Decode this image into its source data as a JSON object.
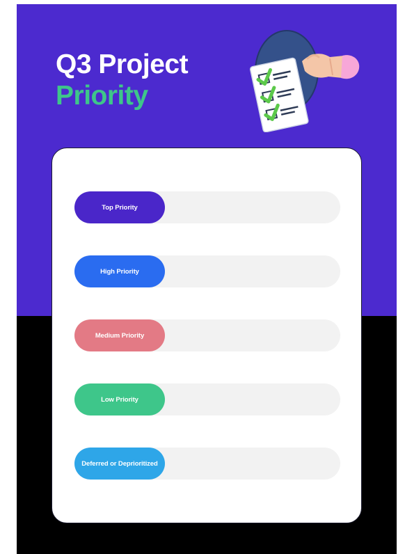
{
  "header": {
    "title_line1": "Q3 Project",
    "title_line2": "Priority"
  },
  "colors": {
    "top_panel": "#4c2acf",
    "bottom_panel": "#000000",
    "title_primary": "#ffffff",
    "title_accent": "#3ec68a",
    "track": "#f2f2f2"
  },
  "illustration": {
    "icon": "checklist-clipboard-with-hand-icon"
  },
  "priorities": [
    {
      "label": "Top Priority",
      "color": "#4a26c9"
    },
    {
      "label": "High Priority",
      "color": "#2a6cf0"
    },
    {
      "label": "Medium Priority",
      "color": "#e37a85"
    },
    {
      "label": "Low Priority",
      "color": "#3ec68a"
    },
    {
      "label": "Deferred or Deprioritized",
      "color": "#2ea6e8"
    }
  ]
}
